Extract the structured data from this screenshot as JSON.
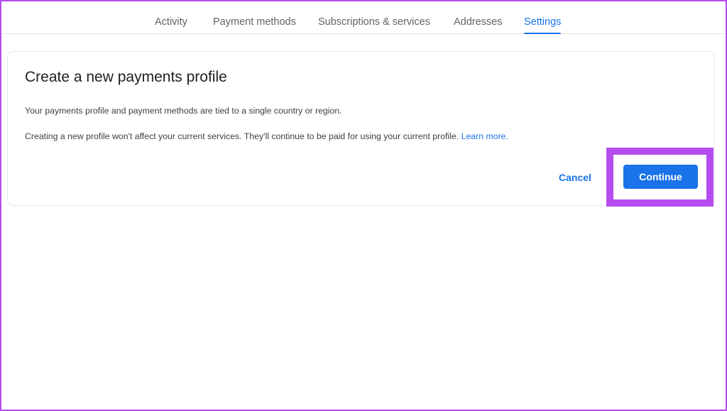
{
  "tabs": [
    {
      "label": "Activity"
    },
    {
      "label": "Payment methods"
    },
    {
      "label": "Subscriptions & services"
    },
    {
      "label": "Addresses"
    },
    {
      "label": "Settings"
    }
  ],
  "active_tab": "Settings",
  "card": {
    "title": "Create a new payments profile",
    "text1": "Your payments profile and payment methods are tied to a single country or region.",
    "text2": "Creating a new profile won't affect your current services. They'll continue to be paid for using your current profile.",
    "learn_more": "Learn more."
  },
  "actions": {
    "cancel_label": "Cancel",
    "continue_label": "Continue"
  },
  "colors": {
    "accent": "#1a73e8",
    "highlight": "#b44cf0"
  }
}
